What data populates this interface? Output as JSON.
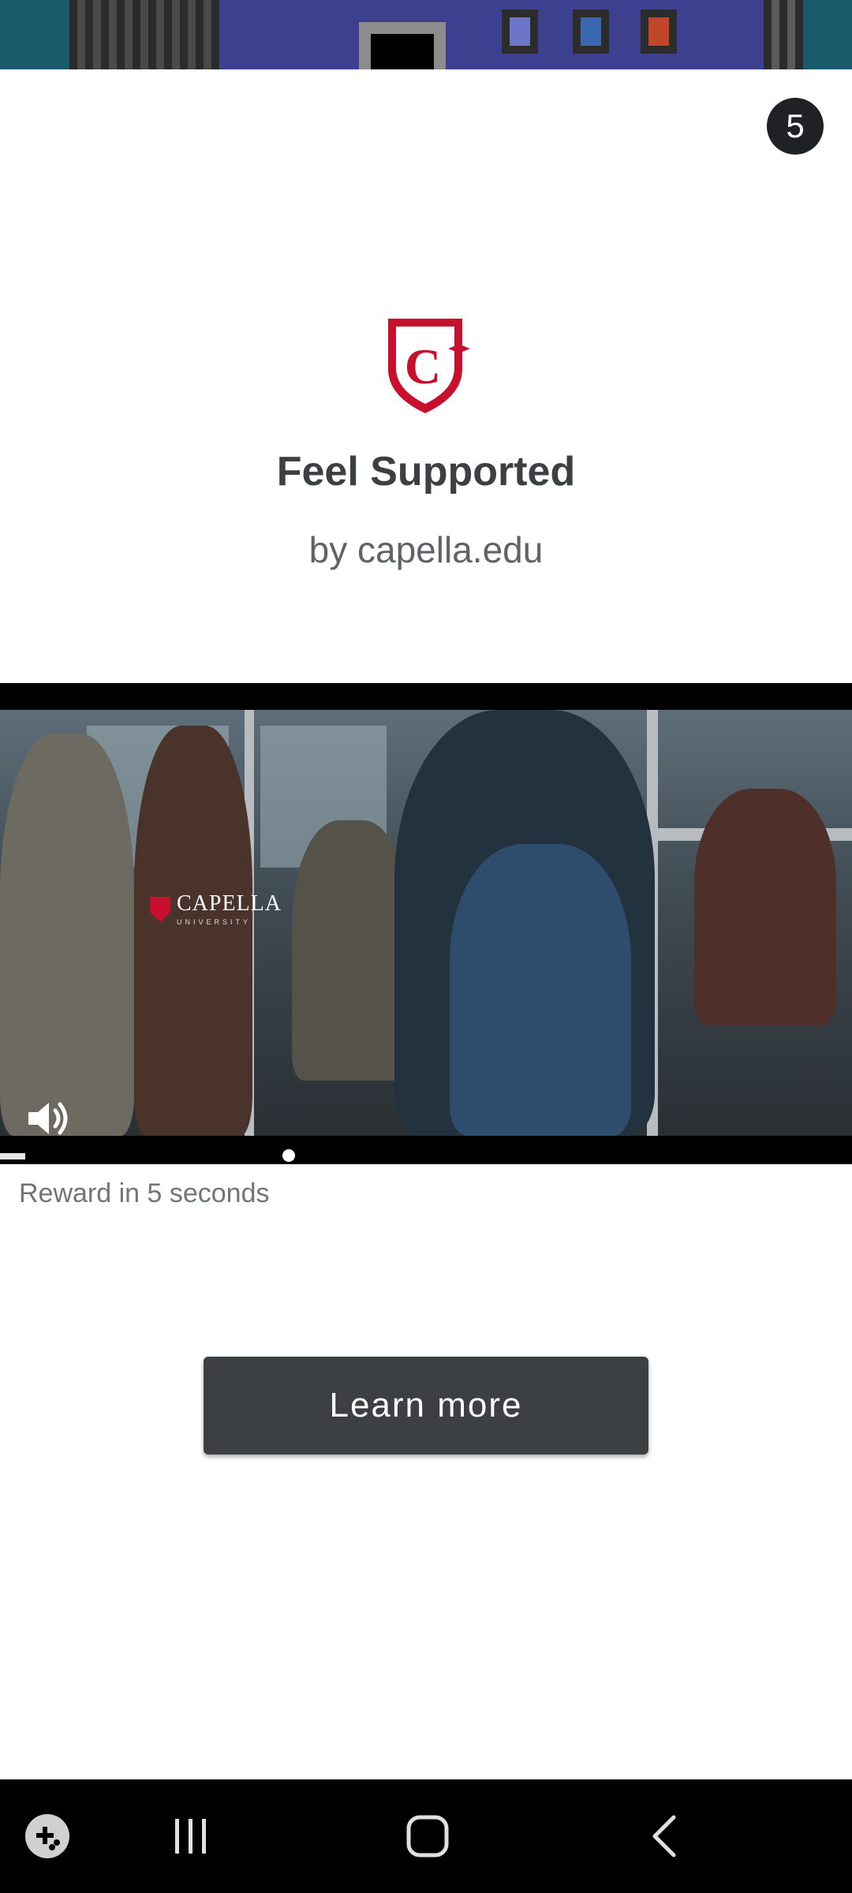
{
  "ad": {
    "countdown": "5",
    "title": "Feel Supported",
    "byline": "by capella.edu",
    "video_brand": "CAPELLA",
    "video_brand_sub": "UNIVERSITY",
    "reward_text": "Reward in 5 seconds",
    "cta_label": "Learn more",
    "progress": 0.03,
    "brand_color": "#c8102e"
  },
  "icons": {
    "logo": "capella-shield-logo",
    "volume": "volume-icon",
    "game_launcher": "game-launcher-icon",
    "recents": "recents-icon",
    "home": "home-icon",
    "back": "back-icon"
  }
}
